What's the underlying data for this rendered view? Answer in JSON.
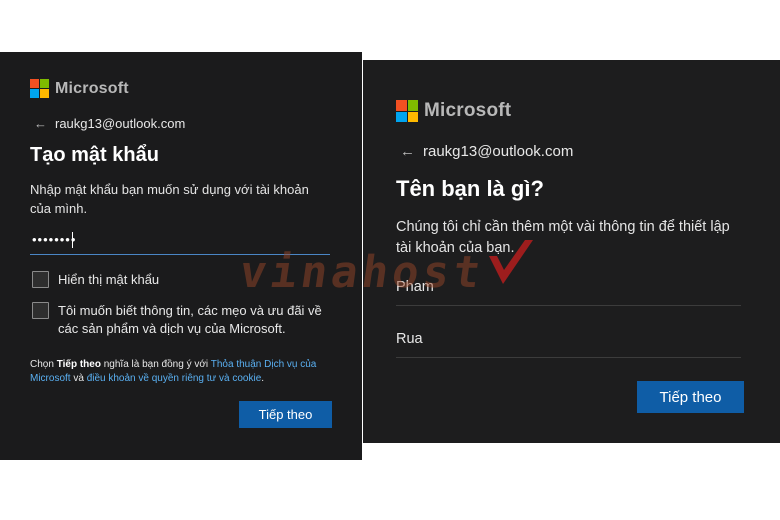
{
  "left_panel": {
    "brand": "Microsoft",
    "email": "raukg13@outlook.com",
    "title": "Tạo mật khẩu",
    "description": "Nhập mật khẩu bạn muốn sử dụng với tài khoản của mình.",
    "password_value": "••••••••",
    "show_password_label": "Hiển thị mật khẩu",
    "promo_label": "Tôi muốn biết thông tin, các mẹo và ưu đãi về các sản phẩm và dịch vụ của Microsoft.",
    "terms": {
      "prefix": "Chọn ",
      "bold": "Tiếp theo",
      "middle": " nghĩa là bạn đồng ý với ",
      "link1": "Thỏa thuận Dịch vụ của Microsoft",
      "and": " và ",
      "link2": "điều khoản về quyền riêng tư và cookie",
      "suffix": "."
    },
    "next_label": "Tiếp theo"
  },
  "right_panel": {
    "brand": "Microsoft",
    "email": "raukg13@outlook.com",
    "title": "Tên bạn là gì?",
    "description": "Chúng tôi chỉ cần thêm một vài thông tin để thiết lập tài khoản của bạn.",
    "last_name_value": "Pham",
    "first_name_value": "Rua",
    "next_label": "Tiếp theo"
  },
  "watermark": "vinahost",
  "icons": {
    "back": "arrow-left-icon",
    "logo": "microsoft-logo-icon"
  },
  "colors": {
    "panel_bg": "#1b1b1c",
    "button": "#0f5da6",
    "link": "#5ab0f2",
    "field_focus": "#4a86c5"
  }
}
